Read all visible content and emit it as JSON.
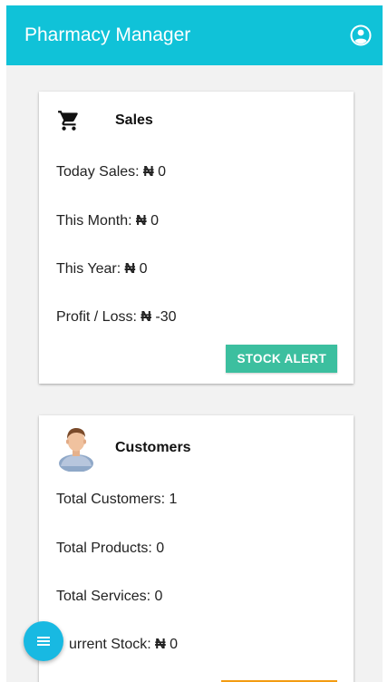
{
  "appbar": {
    "title": "Pharmacy Manager",
    "profile_icon": "account-circle-icon",
    "color": "#10c2d8"
  },
  "sales_card": {
    "icon": "cart-icon",
    "title": "Sales",
    "currency": "₦",
    "stats": [
      {
        "label": "Today Sales:",
        "value": "0"
      },
      {
        "label": "This Month:",
        "value": "0"
      },
      {
        "label": "This Year:",
        "value": "0"
      },
      {
        "label": "Profit / Loss:",
        "value": "-30"
      }
    ],
    "button_label": "STOCK ALERT",
    "button_color": "#3cbf9f"
  },
  "customers_card": {
    "icon": "customer-avatar-icon",
    "title": "Customers",
    "stats": [
      {
        "label": "Total Customers:",
        "value": "1"
      },
      {
        "label": "Total Products:",
        "value": "0"
      },
      {
        "label": "Total Services:",
        "value": "0"
      }
    ],
    "current_stock": {
      "label": "urrent Stock:",
      "currency": "₦",
      "value": "0"
    },
    "button_color": "#f39c12"
  },
  "fab": {
    "icon": "menu-icon",
    "color": "#18b9e2"
  }
}
